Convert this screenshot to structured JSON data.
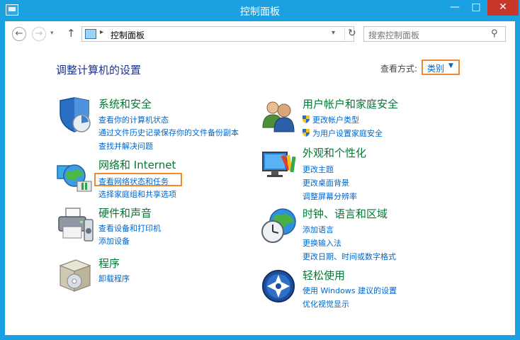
{
  "window": {
    "title": "控制面板",
    "controls": {
      "minimize": "—",
      "maximize": "□",
      "close": "✕"
    }
  },
  "nav": {
    "back": "←",
    "forward": "→",
    "dropdown": "▾",
    "up": "↑",
    "address_separator": "▸",
    "address_text": "控制面板",
    "address_dropdown": "▾",
    "refresh": "↻",
    "search_placeholder": "搜索控制面板",
    "search_glyph": "⚲"
  },
  "header": {
    "title": "调整计算机的设置",
    "view_by_label": "查看方式:",
    "view_by_value": "类别",
    "view_by_caret": "▼"
  },
  "categories_left": [
    {
      "title": "系统和安全",
      "icon": "shield-icon",
      "links": [
        "查看你的计算机状态",
        "通过文件历史记录保存你的文件备份副本",
        "查找并解决问题"
      ]
    },
    {
      "title": "网络和 Internet",
      "icon": "network-globe-icon",
      "links": [
        "查看网络状态和任务",
        "选择家庭组和共享选项"
      ]
    },
    {
      "title": "硬件和声音",
      "icon": "printer-icon",
      "links": [
        "查看设备和打印机",
        "添加设备"
      ]
    },
    {
      "title": "程序",
      "icon": "programs-box-icon",
      "links": [
        "卸载程序"
      ]
    }
  ],
  "categories_right": [
    {
      "title": "用户帐户和家庭安全",
      "icon": "users-icon",
      "links": [
        "更改帐户类型",
        "为用户设置家庭安全"
      ]
    },
    {
      "title": "外观和个性化",
      "icon": "monitor-palette-icon",
      "links": [
        "更改主题",
        "更改桌面背景",
        "调整屏幕分辨率"
      ]
    },
    {
      "title": "时钟、语言和区域",
      "icon": "clock-globe-icon",
      "links": [
        "添加语言",
        "更换输入法",
        "更改日期、时间或数字格式"
      ]
    },
    {
      "title": "轻松使用",
      "icon": "ease-of-access-icon",
      "links": [
        "使用 Windows 建议的设置",
        "优化视觉显示"
      ]
    }
  ],
  "colors": {
    "frame": "#1ba1e2",
    "category_title": "#007a33",
    "link": "#0066cc",
    "highlight": "#f08a2c",
    "close_button": "#c7372a"
  }
}
